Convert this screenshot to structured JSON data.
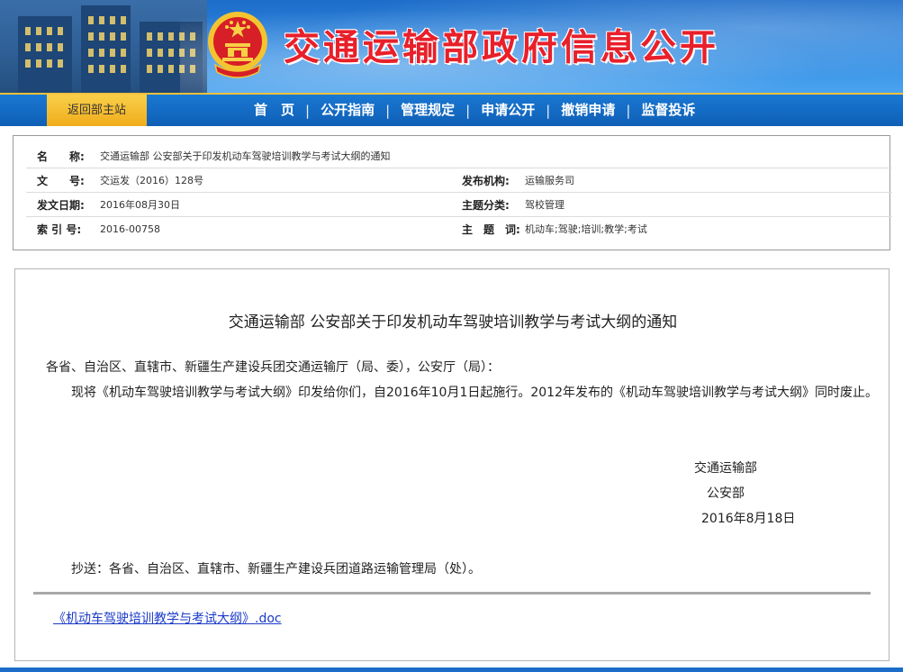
{
  "header": {
    "title": "交通运输部政府信息公开",
    "back_link": "返回部主站"
  },
  "nav": {
    "items": [
      "首　页",
      "公开指南",
      "管理规定",
      "申请公开",
      "撤销申请",
      "监督投诉"
    ]
  },
  "meta": {
    "name_label": "名　　称:",
    "name_value": "交通运输部 公安部关于印发机动车驾驶培训教学与考试大纲的通知",
    "doc_no_label": "文　　号:",
    "doc_no_value": "交运发（2016）128号",
    "publisher_label": "发布机构:",
    "publisher_value": "运输服务司",
    "date_label": "发文日期:",
    "date_value": "2016年08月30日",
    "category_label": "主题分类:",
    "category_value": "驾校管理",
    "index_label": "索 引 号:",
    "index_value": "2016-00758",
    "keywords_label": "主　题　词:",
    "keywords_value": "机动车;驾驶;培训;教学;考试"
  },
  "document": {
    "title": "交通运输部 公安部关于印发机动车驾驶培训教学与考试大纲的通知",
    "recipients": "各省、自治区、直辖市、新疆生产建设兵团交通运输厅（局、委），公安厅（局）：",
    "body": "现将《机动车驾驶培训教学与考试大纲》印发给你们，自2016年10月1日起施行。2012年发布的《机动车驾驶培训教学与考试大纲》同时废止。",
    "signer_1": "交通运输部",
    "signer_2": "公安部",
    "sign_date": "2016年8月18日",
    "cc": "抄送：各省、自治区、直辖市、新疆生产建设兵团道路运输管理局（处）。",
    "attachment": "《机动车驾驶培训教学与考试大纲》.doc"
  },
  "colors": {
    "banner_blue": "#2e86de",
    "title_red": "#e8202a",
    "nav_blue": "#1a78d3",
    "accent_gold": "#f0ad1b",
    "link_blue": "#1a3ac8"
  }
}
